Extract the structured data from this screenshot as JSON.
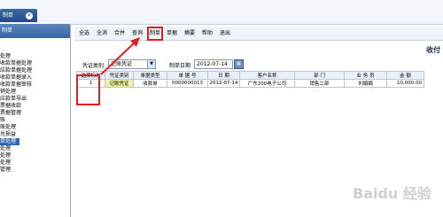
{
  "window": {
    "tab_title": "制单",
    "tab_close": "✕"
  },
  "sidebar": {
    "title": "制单",
    "items": [
      {
        "label": "处理"
      },
      {
        "label": "收款单据处理"
      },
      {
        "label": "应款单据处理"
      },
      {
        "label": "收款单据录入"
      },
      {
        "label": "收款单据审核"
      },
      {
        "label": "销处理"
      },
      {
        "label": "应款单导出"
      },
      {
        "label": "票据收款"
      },
      {
        "label": "票据管理"
      },
      {
        "label": "账"
      },
      {
        "label": "账处理"
      },
      {
        "label": "兑损益"
      },
      {
        "label": "单处理",
        "selected": true
      },
      {
        "label": "处理"
      },
      {
        "label": "处理"
      },
      {
        "label": "处理"
      },
      {
        "label": "管理"
      }
    ]
  },
  "toolbar": {
    "items": [
      "全选",
      "全消",
      "合并",
      "查询",
      "制单",
      "单据",
      "摘要",
      "帮助",
      "退出"
    ],
    "highlighted": "制单"
  },
  "form": {
    "title": "收付",
    "voucher_type_label": "凭证类别",
    "voucher_type_value": "记账凭证",
    "date_label": "制单日期",
    "date_value": "2012-07-14",
    "calendar_icon": "calendar-icon"
  },
  "table": {
    "headers": [
      "选择标志",
      "凭证类别",
      "单据类型",
      "单 据 号",
      "日 期",
      "客户名称",
      "部 门",
      "业 务 员",
      "金 额"
    ],
    "rows": [
      [
        "1",
        "记账凭证",
        "收款单",
        "0000000013",
        "2012-07-14",
        "广东200电子公司",
        "销售二部",
        "刘娟娟",
        "10,000.00"
      ]
    ]
  },
  "watermark": "Baidu 经验",
  "colors": {
    "highlight": "#e02020",
    "accent": "#3166b0",
    "tag_bg": "#f3f1a4"
  }
}
